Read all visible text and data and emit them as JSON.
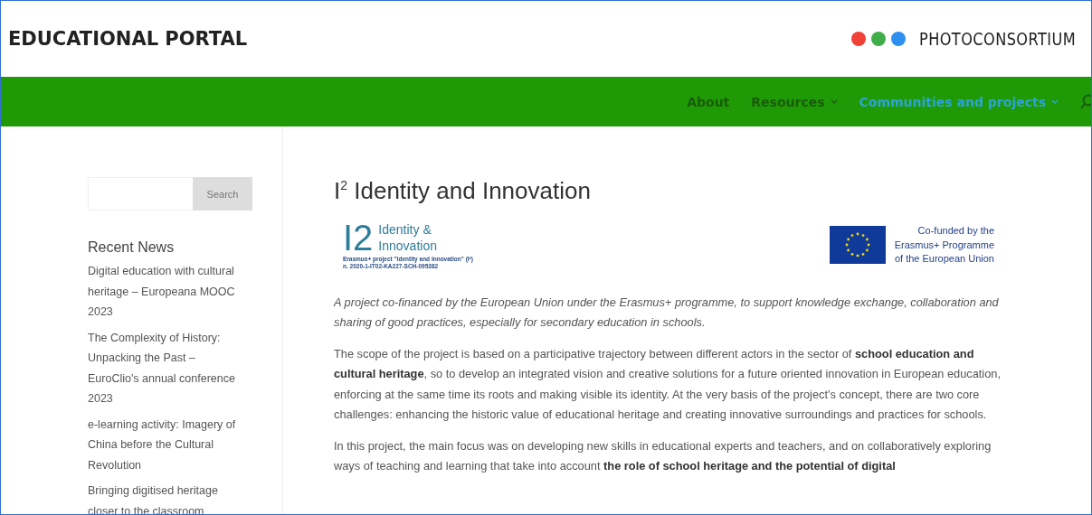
{
  "header": {
    "site_title": "EDUCATIONAL PORTAL",
    "brand": "PHOTOCONSORTIUM"
  },
  "nav": [
    {
      "label": "About",
      "selected": false,
      "has_submenu": false
    },
    {
      "label": "Resources",
      "selected": false,
      "has_submenu": true
    },
    {
      "label": "Communities and projects",
      "selected": true,
      "has_submenu": true
    }
  ],
  "sidebar": {
    "search": {
      "button": "Search"
    },
    "recent_news": {
      "heading": "Recent News",
      "items": [
        "Digital education with cultural heritage – Europeana MOOC 2023",
        "The Complexity of History: Unpacking the Past – EuroClio's annual conference 2023",
        "e-learning activity: Imagery of China before the Cultural Revolution",
        "Bringing digitised heritage closer to the classroom"
      ]
    }
  },
  "article": {
    "title": "I$^{2}$ Identity and Innovation",
    "logo": {
      "mark": "I2",
      "name_lines": [
        "Identity &",
        "Innovation"
      ],
      "caption_lines": [
        "Erasmus+ project \"Identity and Innovation\" (I²)",
        "n. 2020-1-IT02-KA227-SCH-095382"
      ]
    },
    "eu_notice": [
      "Co-funded by the",
      "Erasmus+ Programme",
      "of the European Union"
    ],
    "paragraphs": [
      {
        "kind": "italic",
        "text": "A project co-financed by the European Union under the Erasmus+ programme, to support knowledge exchange, collaboration and sharing of good practices, especially for secondary education in schools."
      },
      {
        "kind": "plain",
        "text": "The scope of the project is based on a participative trajectory between different actors in the sector of **school education and cultural heritage**, so to develop an integrated vision and creative solutions for a future oriented innovation in European education, enforcing at the same time its roots and making visible its identity. At the very basis of the project's concept, there are two core challenges: enhancing the historic value of educational heritage and creating innovative surroundings and practices for schools."
      },
      {
        "kind": "plain",
        "text": "In this project, the main focus was on developing new skills in educational experts and teachers, and on collaboratively exploring ways of teaching and learning that take into account **the role of school heritage and the potential of digital**"
      }
    ]
  }
}
